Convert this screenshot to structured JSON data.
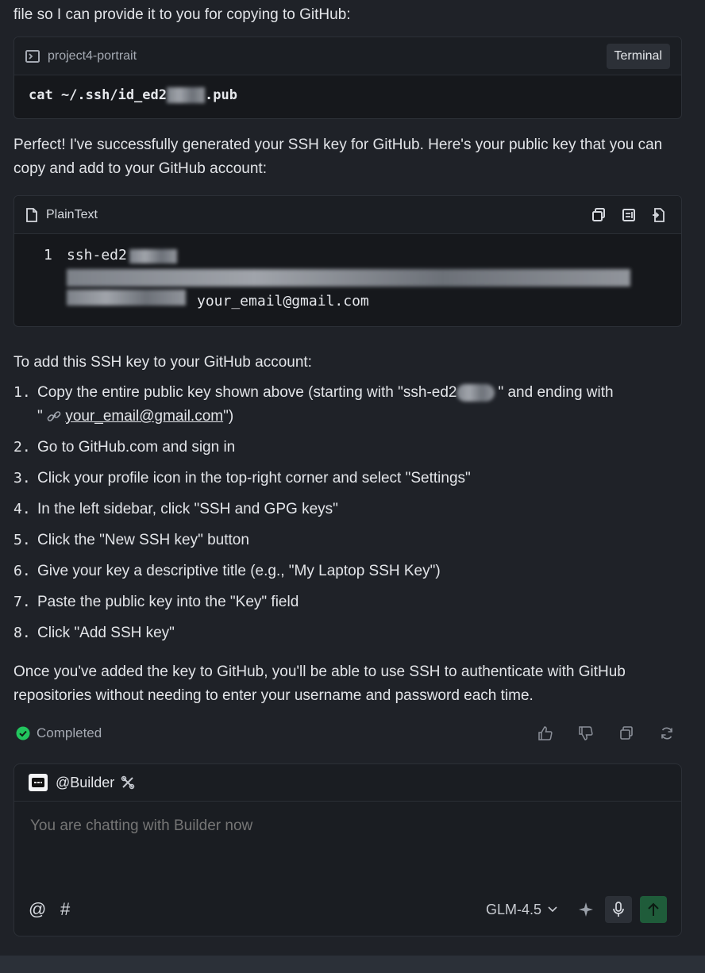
{
  "intro": {
    "text": "file so I can provide it to you for copying to GitHub:"
  },
  "terminal": {
    "project": "project4-portrait",
    "badge": "Terminal",
    "command_start": "cat ~/.ssh/id_ed2",
    "command_end": ".pub"
  },
  "summary": {
    "text": "Perfect! I've successfully generated your SSH key for GitHub. Here's your public key that you can copy and add to your GitHub account:"
  },
  "code_block": {
    "language": "PlainText",
    "line_number": "1",
    "line_start": "ssh-ed2",
    "line_end": "your_email@gmail.com"
  },
  "instructions": {
    "heading": "To add this SSH key to your GitHub account:",
    "steps": [
      {
        "num": "1.",
        "text_a": "Copy the entire public key shown above (starting with \"ssh-ed2",
        "text_b": "\" and ending with",
        "text_c": "\"",
        "email": "your_email@gmail.com",
        "text_d": "\")"
      },
      {
        "num": "2.",
        "text": "Go to GitHub.com and sign in"
      },
      {
        "num": "3.",
        "text": "Click your profile icon in the top-right corner and select \"Settings\""
      },
      {
        "num": "4.",
        "text": "In the left sidebar, click \"SSH and GPG keys\""
      },
      {
        "num": "5.",
        "text": "Click the \"New SSH key\" button"
      },
      {
        "num": "6.",
        "text": "Give your key a descriptive title (e.g., \"My Laptop SSH Key\")"
      },
      {
        "num": "7.",
        "text": "Paste the public key into the \"Key\" field"
      },
      {
        "num": "8.",
        "text": "Click \"Add SSH key\""
      }
    ]
  },
  "closing": {
    "text": "Once you've added the key to GitHub, you'll be able to use SSH to authenticate with GitHub repositories without needing to enter your username and password each time."
  },
  "status": {
    "label": "Completed",
    "color": "#22c55e"
  },
  "composer": {
    "agent": "@Builder",
    "placeholder": "You are chatting with Builder now",
    "model": "GLM-4.5",
    "send_color": "#1f5c3a"
  }
}
